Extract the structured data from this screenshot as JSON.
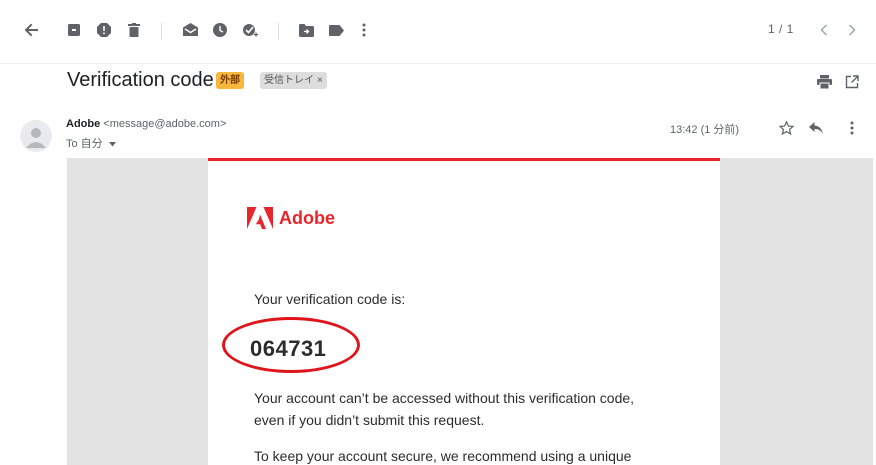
{
  "toolbar": {
    "back_icon": "arrow-back-icon",
    "actions": [
      "archive-icon",
      "report-spam-icon",
      "delete-icon",
      "mark-unread-icon",
      "snooze-icon",
      "add-task-icon",
      "move-to-icon",
      "label-icon",
      "more-vert-icon"
    ],
    "pager": "1 / 1"
  },
  "email": {
    "subject": "Verification code",
    "label_external": "外部",
    "label_inbox": "受信トレイ",
    "label_close": "×",
    "sender_name": "Adobe",
    "sender_address": "<message@adobe.com>",
    "to_line": "To 自分",
    "time": "13:42 (1 分前)"
  },
  "message": {
    "brand": "Adobe",
    "intro": "Your verification code is:",
    "code": "064731",
    "line1": "Your account can’t be accessed without this verification code,",
    "line2": "even if you didn’t submit this request.",
    "line3": "To keep your account secure, we recommend using a unique"
  },
  "colors": {
    "adobe_red": "#e8252b",
    "label_external_bg": "#f6b73c",
    "highlight_circle": "#e0141b"
  }
}
